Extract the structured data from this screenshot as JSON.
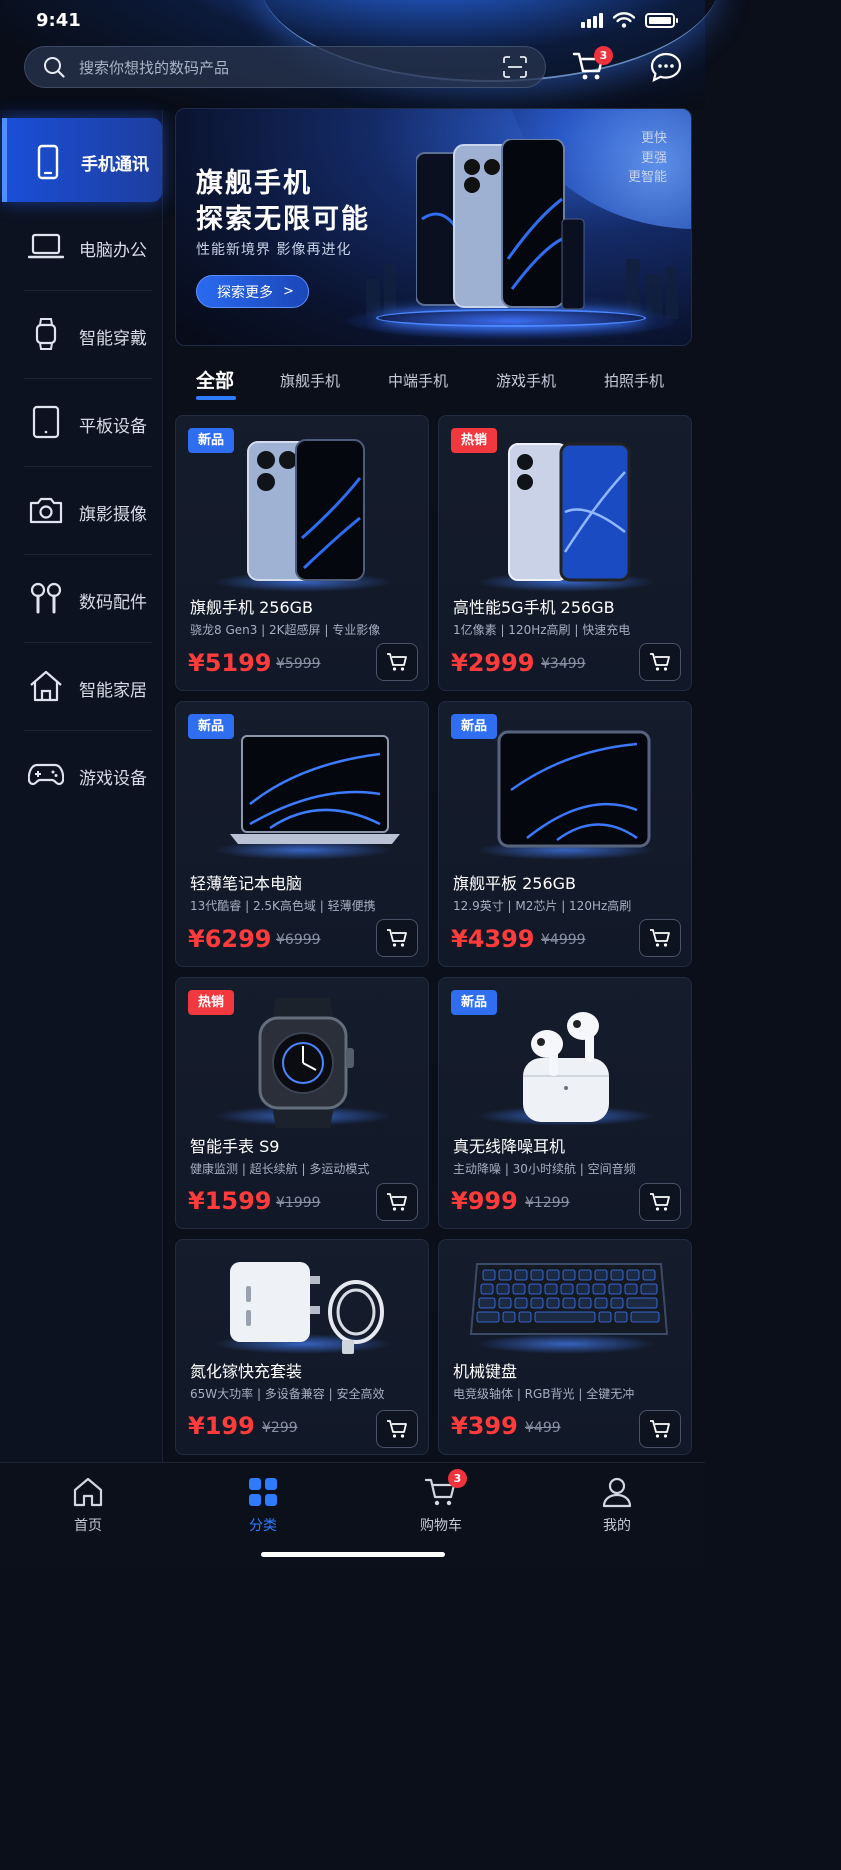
{
  "status": {
    "time": "9:41"
  },
  "search": {
    "placeholder": "搜索你想找的数码产品"
  },
  "header": {
    "cart_badge": "3"
  },
  "sidebar": {
    "items": [
      {
        "label": "手机通讯",
        "icon": "phone-icon",
        "active": true
      },
      {
        "label": "电脑办公",
        "icon": "laptop-icon"
      },
      {
        "label": "智能穿戴",
        "icon": "watch-icon"
      },
      {
        "label": "平板设备",
        "icon": "tablet-icon"
      },
      {
        "label": "旗影摄像",
        "icon": "camera-icon"
      },
      {
        "label": "数码配件",
        "icon": "earbuds-icon"
      },
      {
        "label": "智能家居",
        "icon": "home-icon"
      },
      {
        "label": "游戏设备",
        "icon": "gamepad-icon"
      }
    ]
  },
  "banner": {
    "title_line1": "旗舰手机",
    "title_line2": "探索无限可能",
    "subtitle": "性能新境界 影像再进化",
    "cta": "探索更多",
    "tags": [
      "更快",
      "更强",
      "更智能"
    ]
  },
  "tabs": [
    {
      "label": "全部",
      "active": true
    },
    {
      "label": "旗舰手机"
    },
    {
      "label": "中端手机"
    },
    {
      "label": "游戏手机"
    },
    {
      "label": "拍照手机"
    }
  ],
  "products": [
    {
      "badge": "新品",
      "badge_type": "new",
      "name": "旗舰手机 256GB",
      "desc": "骁龙8 Gen3 | 2K超感屏 | 专业影像",
      "price": "¥5199",
      "old_price": "¥5999",
      "image": "phone-pro"
    },
    {
      "badge": "热销",
      "badge_type": "hot",
      "name": "高性能5G手机 256GB",
      "desc": "1亿像素 | 120Hz高刷 | 快速充电",
      "price": "¥2999",
      "old_price": "¥3499",
      "image": "phone-5g"
    },
    {
      "badge": "新品",
      "badge_type": "new",
      "name": "轻薄笔记本电脑",
      "desc": "13代酷睿 | 2.5K高色域 | 轻薄便携",
      "price": "¥6299",
      "old_price": "¥6999",
      "image": "laptop"
    },
    {
      "badge": "新品",
      "badge_type": "new",
      "name": "旗舰平板 256GB",
      "desc": "12.9英寸 | M2芯片 | 120Hz高刷",
      "price": "¥4399",
      "old_price": "¥4999",
      "image": "tablet"
    },
    {
      "badge": "热销",
      "badge_type": "hot",
      "name": "智能手表 S9",
      "desc": "健康监测 | 超长续航 | 多运动模式",
      "price": "¥1599",
      "old_price": "¥1999",
      "image": "watch"
    },
    {
      "badge": "新品",
      "badge_type": "new",
      "name": "真无线降噪耳机",
      "desc": "主动降噪 | 30小时续航 | 空间音频",
      "price": "¥999",
      "old_price": "¥1299",
      "image": "earbuds"
    },
    {
      "badge": "",
      "badge_type": "",
      "name": "氮化镓快充套装",
      "desc": "65W大功率 | 多设备兼容 | 安全高效",
      "price": "¥199",
      "old_price": "¥299",
      "image": "charger"
    },
    {
      "badge": "",
      "badge_type": "",
      "name": "机械键盘",
      "desc": "电竞级轴体 | RGB背光 | 全键无冲",
      "price": "¥399",
      "old_price": "¥499",
      "image": "keyboard"
    }
  ],
  "bottom_nav": [
    {
      "label": "首页",
      "icon": "home-icon"
    },
    {
      "label": "分类",
      "icon": "category-icon",
      "active": true
    },
    {
      "label": "购物车",
      "icon": "cart-icon",
      "badge": "3"
    },
    {
      "label": "我的",
      "icon": "profile-icon"
    }
  ],
  "colors": {
    "accent": "#2f7bff",
    "price": "#ff3b3b",
    "hot_badge": "#f0383e",
    "new_badge": "#2f6ef0",
    "background": "#0a0f1a"
  }
}
